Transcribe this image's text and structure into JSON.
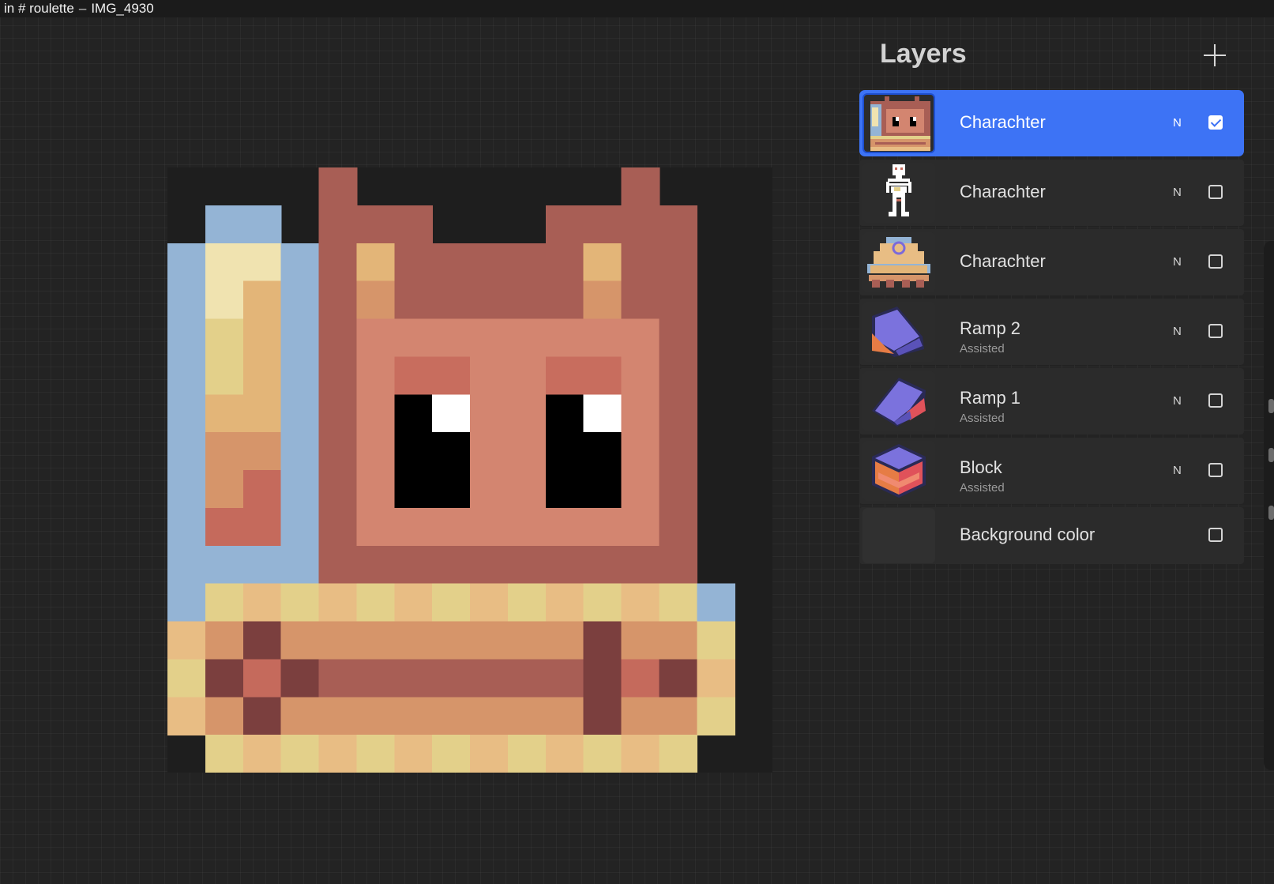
{
  "title_bar": {
    "channel": "in # roulette",
    "separator": "–",
    "file_name": "IMG_4930"
  },
  "layers_panel": {
    "title": "Layers",
    "add_icon": "plus-icon",
    "layers": [
      {
        "name": "Charachter",
        "subtitle": "",
        "blend": "N",
        "visible": true,
        "selected": true,
        "thumb": "box-character"
      },
      {
        "name": "Charachter",
        "subtitle": "",
        "blend": "N",
        "visible": false,
        "selected": false,
        "thumb": "skeleton-character"
      },
      {
        "name": "Charachter",
        "subtitle": "",
        "blend": "N",
        "visible": false,
        "selected": false,
        "thumb": "dome-character"
      },
      {
        "name": "Ramp 2",
        "subtitle": "Assisted",
        "blend": "N",
        "visible": false,
        "selected": false,
        "thumb": "ramp-2"
      },
      {
        "name": "Ramp 1",
        "subtitle": "Assisted",
        "blend": "N",
        "visible": false,
        "selected": false,
        "thumb": "ramp-1"
      },
      {
        "name": "Block",
        "subtitle": "Assisted",
        "blend": "N",
        "visible": false,
        "selected": false,
        "thumb": "block"
      }
    ],
    "background_layer": {
      "name": "Background color",
      "visible": false
    }
  },
  "canvas": {
    "subject": "pixel-art box character",
    "palette": {
      "blue": "#94b4d5",
      "cream": "#f0e3b0",
      "tan": "#e3b578",
      "gold": "#e3d08a",
      "peach": "#d6956a",
      "rust": "#c56a5c",
      "brown": "#a85e55",
      "salmon": "#d38570",
      "eye_lid": "#c86d5e",
      "dark": "#7b3f3e",
      "stripe_a": "#e3d08a",
      "stripe_b": "#e8bd84",
      "black": "#000000",
      "white": "#ffffff",
      "transparent_bg": "#1e1e1e"
    }
  }
}
